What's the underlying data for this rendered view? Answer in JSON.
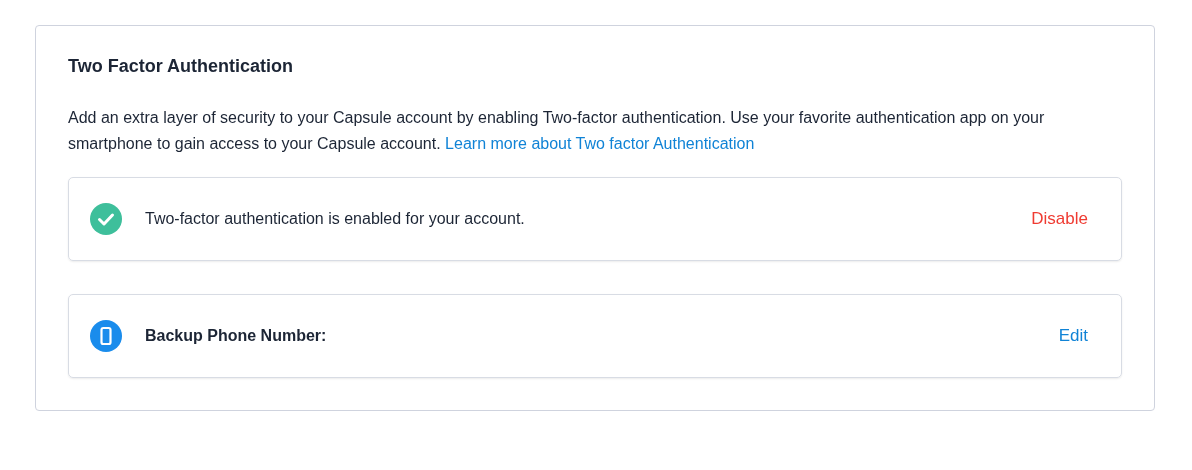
{
  "card": {
    "title": "Two Factor Authentication",
    "description": "Add an extra layer of security to your Capsule account by enabling Two-factor authentication. Use your favorite authentication app on your smartphone to gain access to your Capsule account.",
    "link": "Learn more about Two factor Authentication"
  },
  "rows": [
    {
      "kind": "status",
      "text": "Two-factor authentication is enabled for your account.",
      "action": {
        "label": "Disable",
        "kind": "danger"
      }
    },
    {
      "kind": "phone",
      "text": "Backup Phone Number:",
      "action": {
        "label": "Edit",
        "kind": "link"
      }
    }
  ]
}
